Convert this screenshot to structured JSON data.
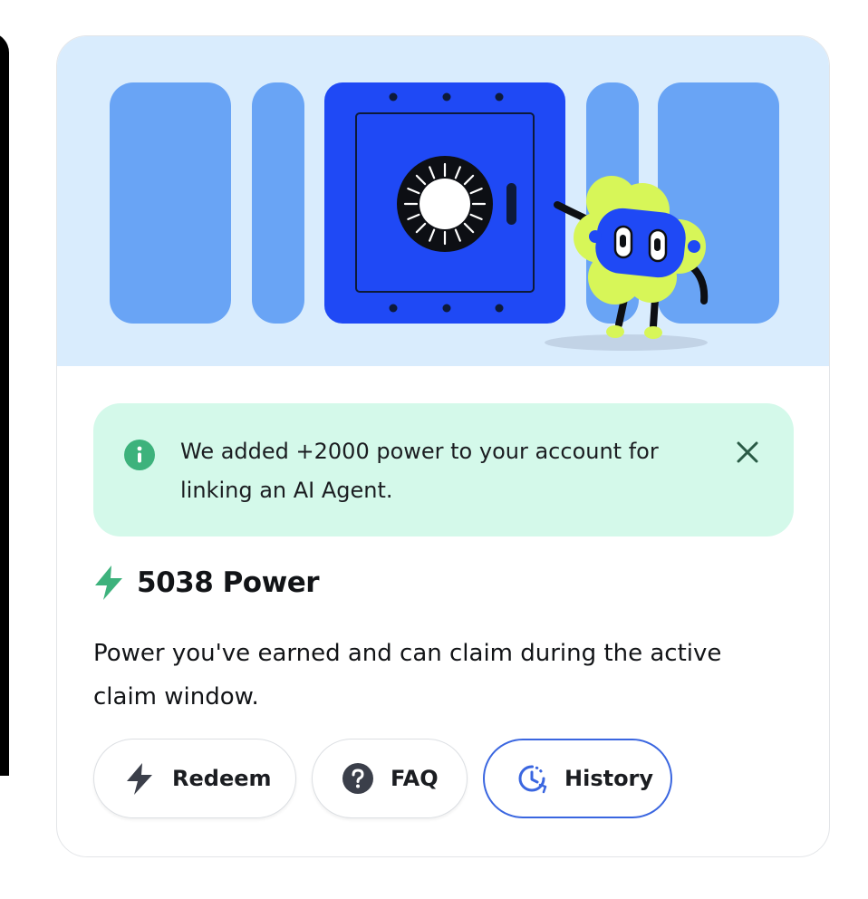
{
  "alert": {
    "message": "We added +2000 power to your account for linking an AI Agent.",
    "icon": "info-icon",
    "close_icon": "close-icon",
    "color": "#d4f9ea"
  },
  "power": {
    "amount_label": "5038 Power",
    "icon": "lightning-bolt-icon",
    "accent_color": "#3db27c"
  },
  "description": "Power you've earned and can claim during the active claim window.",
  "actions": [
    {
      "label": "Redeem",
      "icon": "lightning-bolt-icon"
    },
    {
      "label": "FAQ",
      "icon": "question-circle-icon"
    },
    {
      "label": "History",
      "icon": "clock-history-icon",
      "selected": true
    }
  ],
  "hero": {
    "background": "#d9ecfd",
    "safe_color": "#1f49f5",
    "panel_color": "#69a4f5",
    "mascot_color": "#d7f658"
  }
}
